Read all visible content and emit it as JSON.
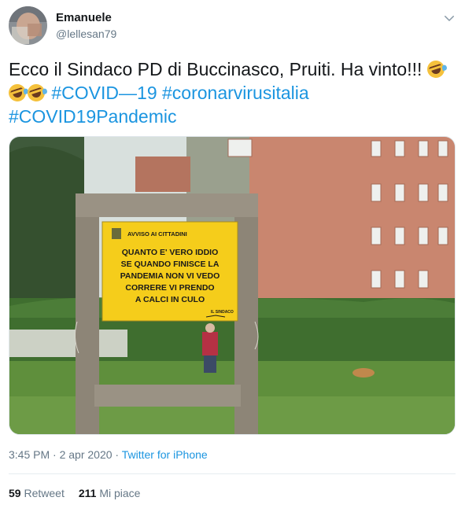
{
  "user": {
    "name": "Emanuele",
    "handle": "@lellesan79"
  },
  "tweet": {
    "text_line1": "Ecco il Sindaco PD di Buccinasco, Pruiti. Ha vinto!!!",
    "emoji_name": "rolling-on-the-floor-laughing",
    "hashtags": [
      "#COVID—19",
      "#coronarvirusitalia",
      "#COVID19Pandemic"
    ]
  },
  "photo": {
    "sign_header": "AVVISO AI CITTADINI",
    "sign_lines": [
      "QUANTO E' VERO IDDIO",
      "SE QUANDO FINISCE LA",
      "PANDEMIA NON VI VEDO",
      "CORRERE VI PRENDO",
      "A CALCI IN CULO"
    ],
    "sign_signature": "IL SINDACO",
    "colors": {
      "sign": "#f5cd1b",
      "building": "#c9866f",
      "grass": "#5f8f3c",
      "hedge": "#3f6e2f"
    }
  },
  "meta": {
    "time": "3:45 PM · 2 apr 2020",
    "separator": " · ",
    "source": "Twitter for iPhone"
  },
  "stats": {
    "retweets_count": "59",
    "retweets_label": "Retweet",
    "likes_count": "211",
    "likes_label": "Mi piace"
  },
  "icons": {
    "caret": "chevron-down-icon"
  }
}
